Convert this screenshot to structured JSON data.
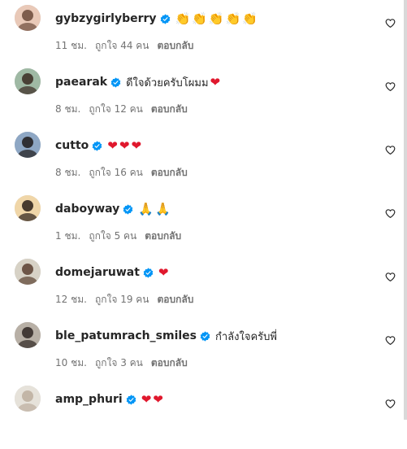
{
  "accent": {
    "verified": "#0095f6",
    "heart": "#e0182d"
  },
  "comments": [
    {
      "username": "gybzygirlyberry",
      "verified": true,
      "text": "",
      "emojis": [
        "👏",
        "👏",
        "👏",
        "👏",
        "👏"
      ],
      "time": "11 ชม.",
      "likes": "ถูกใจ 44 คน",
      "reply": "ตอบกลับ",
      "like_icon": "heart-outline-icon"
    },
    {
      "username": "paearak",
      "verified": true,
      "text": "ดีใจด้วยครับโผมม",
      "emojis": [
        "❤"
      ],
      "time": "8 ชม.",
      "likes": "ถูกใจ 12 คน",
      "reply": "ตอบกลับ",
      "like_icon": "heart-outline-icon"
    },
    {
      "username": "cutto",
      "verified": true,
      "text": "",
      "emojis": [
        "❤",
        "❤",
        "❤"
      ],
      "time": "8 ชม.",
      "likes": "ถูกใจ 16 คน",
      "reply": "ตอบกลับ",
      "like_icon": "heart-outline-icon"
    },
    {
      "username": "daboyway",
      "verified": true,
      "text": "",
      "emojis": [
        "🙏",
        "🙏"
      ],
      "time": "1 ชม.",
      "likes": "ถูกใจ 5 คน",
      "reply": "ตอบกลับ",
      "like_icon": "heart-outline-icon"
    },
    {
      "username": "domejaruwat",
      "verified": true,
      "text": "",
      "emojis": [
        "❤"
      ],
      "time": "12 ชม.",
      "likes": "ถูกใจ 19 คน",
      "reply": "ตอบกลับ",
      "like_icon": "heart-outline-icon"
    },
    {
      "username": "ble_patumrach_smiles",
      "verified": true,
      "text": "กำลังใจครับพี่",
      "emojis": [],
      "time": "10 ชม.",
      "likes": "ถูกใจ 3 คน",
      "reply": "ตอบกลับ",
      "like_icon": "heart-outline-icon"
    },
    {
      "username": "amp_phuri",
      "verified": true,
      "text": "",
      "emojis": [
        "❤",
        "❤"
      ],
      "time": "",
      "likes": "",
      "reply": "",
      "like_icon": "heart-outline-icon"
    }
  ]
}
